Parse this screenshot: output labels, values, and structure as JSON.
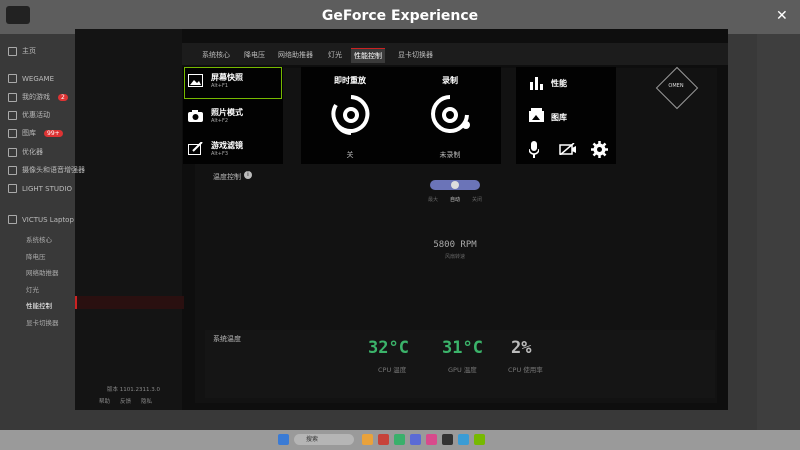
{
  "overlay": {
    "title": "GeForce Experience"
  },
  "sidebar": {
    "items": [
      {
        "label": "主页"
      },
      {
        "label": "WEGAME"
      },
      {
        "label": "我的游戏",
        "badge": "2"
      },
      {
        "label": "优惠活动"
      },
      {
        "label": "图库",
        "badge": "99+"
      },
      {
        "label": "优化器"
      },
      {
        "label": "摄像头和语音增强器"
      },
      {
        "label": "LIGHT STUDIO"
      },
      {
        "label": "VICTUS Laptop"
      }
    ],
    "sub_items": [
      "系统核心",
      "降电压",
      "网络助推器",
      "灯光",
      "性能控制",
      "显卡切换器"
    ],
    "version": "版本 1101.2311.3.0",
    "footer": [
      "帮助",
      "反馈",
      "隐私"
    ]
  },
  "tabs": [
    "系统核心",
    "降电压",
    "网络助推器",
    "灯光",
    "性能控制",
    "显卡切换器"
  ],
  "active_tab_index": 4,
  "overlay_left": [
    {
      "title": "屏幕快照",
      "shortcut": "Alt+F1"
    },
    {
      "title": "照片模式",
      "shortcut": "Alt+F2"
    },
    {
      "title": "游戏滤镜",
      "shortcut": "Alt+F3"
    }
  ],
  "overlay_mid": {
    "replay": {
      "title": "即时重放",
      "status": "关"
    },
    "record": {
      "title": "录制",
      "status": "未录制"
    }
  },
  "overlay_right": {
    "performance": "性能",
    "gallery": "图库"
  },
  "content": {
    "temp_control": "温度控制",
    "fan_speed": "5800 RPM",
    "fan_label": "风扇转速",
    "fan_modes": [
      "最大",
      "自动",
      "关闭"
    ],
    "system_temp": "系统温度",
    "brand_text": "OMEN"
  },
  "stats": [
    {
      "value": "32°C",
      "label": "CPU 温度"
    },
    {
      "value": "31°C",
      "label": "GPU 温度"
    },
    {
      "value": "2%",
      "label": "CPU 使用率"
    }
  ],
  "taskbar": {
    "search": "搜索"
  },
  "colors": {
    "accent": "#76b900",
    "stat": "#3bb36a",
    "alert": "#cc2222"
  }
}
